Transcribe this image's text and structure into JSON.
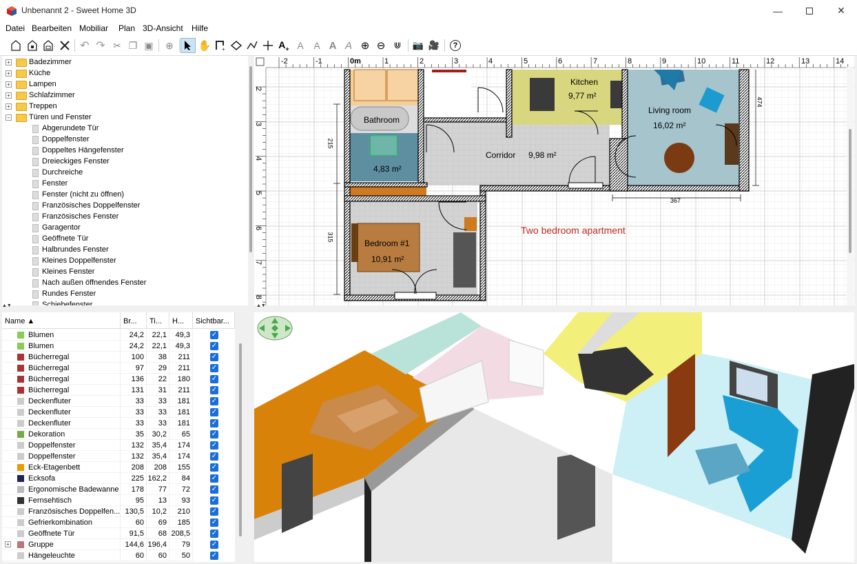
{
  "window": {
    "title": "Unbenannt 2 - Sweet Home 3D"
  },
  "menu": [
    "Datei",
    "Bearbeiten",
    "Mobiliar",
    "Plan",
    "3D-Ansicht",
    "Hilfe"
  ],
  "catalog": {
    "folders": [
      "Badezimmer",
      "Küche",
      "Lampen",
      "Schlafzimmer",
      "Treppen",
      "Türen und Fenster"
    ],
    "items": [
      "Abgerundete Tür",
      "Doppelfenster",
      "Doppeltes Hängefenster",
      "Dreieckiges Fenster",
      "Durchreiche",
      "Fenster",
      "Fenster (nicht zu öffnen)",
      "Französisches Doppelfenster",
      "Französisches Fenster",
      "Garagentor",
      "Geöffnete Tür",
      "Halbrundes Fenster",
      "Kleines Doppelfenster",
      "Kleines Fenster",
      "Nach außen öffnendes Fenster",
      "Rundes Fenster",
      "Schiebefenster"
    ]
  },
  "furniture_table": {
    "headers": [
      "Name ▲",
      "Br...",
      "Ti...",
      "H...",
      "Sichtbar..."
    ],
    "rows": [
      [
        "Blumen",
        "24,2",
        "22,1",
        "49,3"
      ],
      [
        "Blumen",
        "24,2",
        "22,1",
        "49,3"
      ],
      [
        "Bücherregal",
        "100",
        "38",
        "211"
      ],
      [
        "Bücherregal",
        "97",
        "29",
        "211"
      ],
      [
        "Bücherregal",
        "136",
        "22",
        "180"
      ],
      [
        "Bücherregal",
        "131",
        "31",
        "211"
      ],
      [
        "Deckenfluter",
        "33",
        "33",
        "181"
      ],
      [
        "Deckenfluter",
        "33",
        "33",
        "181"
      ],
      [
        "Deckenfluter",
        "33",
        "33",
        "181"
      ],
      [
        "Dekoration",
        "35",
        "30,2",
        "65"
      ],
      [
        "Doppelfenster",
        "132",
        "35,4",
        "174"
      ],
      [
        "Doppelfenster",
        "132",
        "35,4",
        "174"
      ],
      [
        "Eck-Etagenbett",
        "208",
        "208",
        "155"
      ],
      [
        "Ecksofa",
        "225",
        "162,2",
        "84"
      ],
      [
        "Ergonomische Badewanne",
        "178",
        "77",
        "72"
      ],
      [
        "Fernsehtisch",
        "95",
        "13",
        "93"
      ],
      [
        "Französisches Doppelfen...",
        "130,5",
        "10,2",
        "210"
      ],
      [
        "Gefrierkombination",
        "60",
        "69",
        "185"
      ],
      [
        "Geöffnete Tür",
        "91,5",
        "68",
        "208,5"
      ],
      [
        "Gruppe",
        "144,6",
        "196,4",
        "79"
      ],
      [
        "Hängeleuchte",
        "60",
        "60",
        "50"
      ]
    ]
  },
  "plan": {
    "ruler_x": [
      "-2",
      "-1",
      "0m",
      "1",
      "2",
      "3",
      "4",
      "5",
      "6",
      "7",
      "8",
      "9",
      "10",
      "11",
      "12",
      "13",
      "14"
    ],
    "ruler_y": [
      "2",
      "3",
      "4",
      "5",
      "6",
      "7",
      "8"
    ],
    "rooms": [
      {
        "name": "Kitchen",
        "area": "9,77 m²"
      },
      {
        "name": "Living room",
        "area": "16,02 m²"
      },
      {
        "name": "Bathroom",
        "area": ""
      },
      {
        "name": "",
        "area": "4,83 m²"
      },
      {
        "name": "Corridor",
        "area": "9,98 m²"
      },
      {
        "name": "Bedroom #1",
        "area": "10,91 m²"
      }
    ],
    "dimensions": [
      "215",
      "315",
      "474",
      "367"
    ],
    "label": "Two bedroom apartment"
  },
  "colors": {
    "accent": "#1a6ed8",
    "plan_label": "#c0281e"
  }
}
